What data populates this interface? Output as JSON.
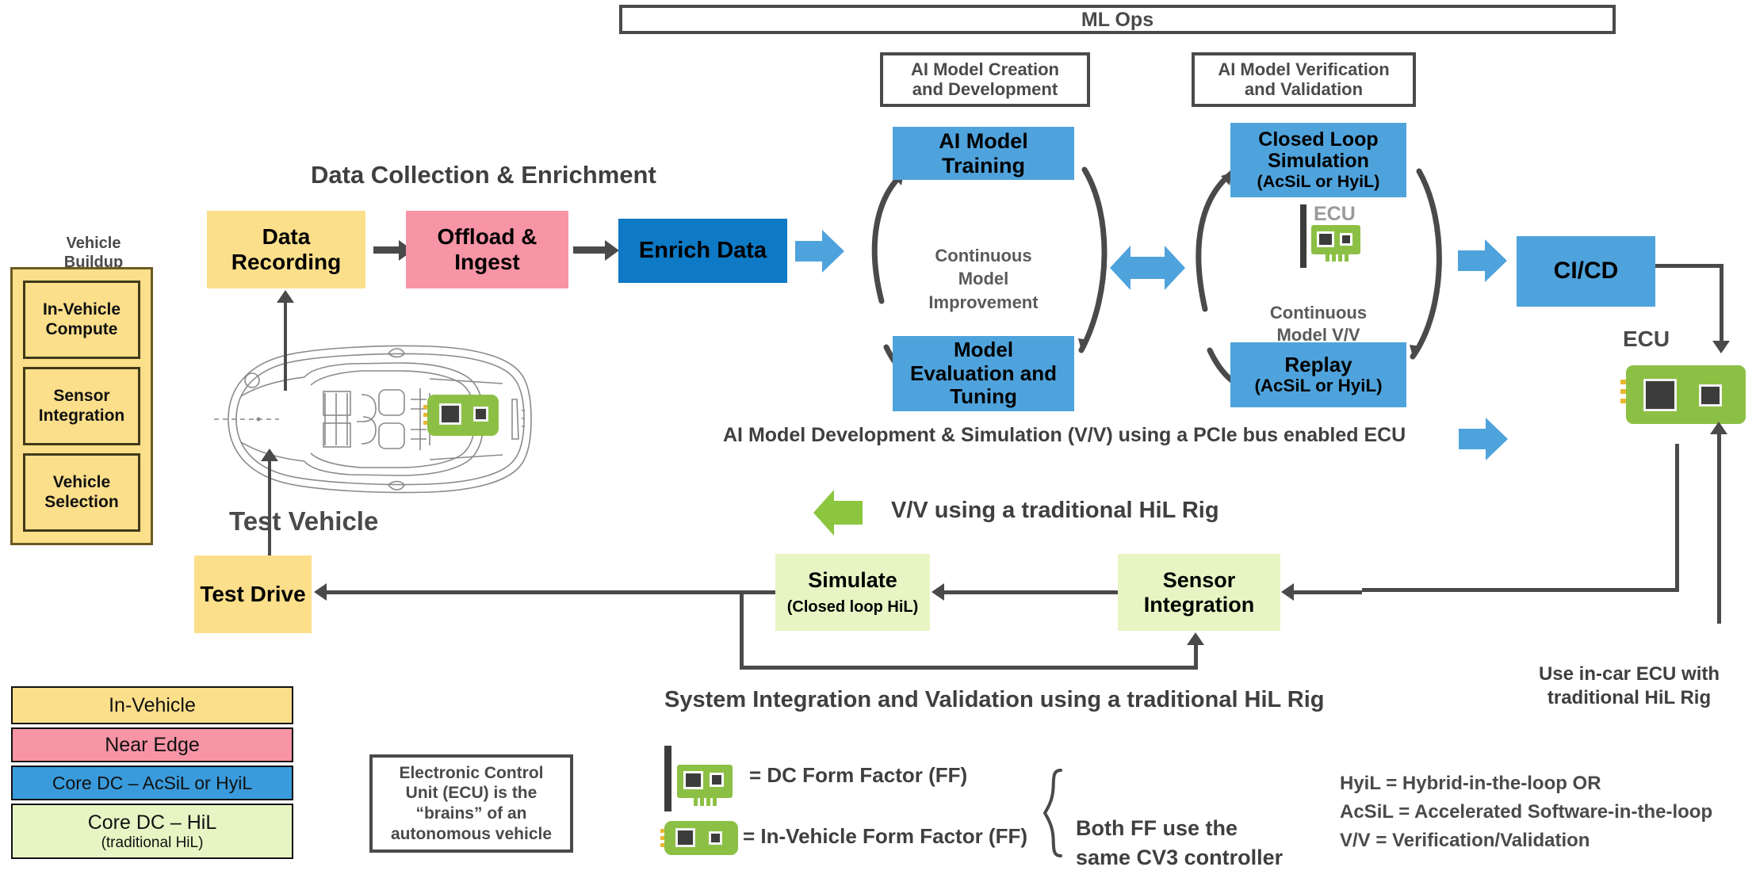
{
  "title_banner": {
    "label": "ML Ops"
  },
  "section_captions": {
    "creation": "AI Model Creation\nand Development",
    "verification": "AI Model Verification\nand Validation",
    "data_collection": "Data Collection & Enrichment",
    "ai_dev_sim": "AI Model Development & Simulation (V/V) using a PCIe bus enabled ECU",
    "vv_traditional": "V/V using a traditional HiL Rig",
    "system_integration": "System Integration and Validation using a traditional HiL Rig",
    "use_in_car_ecu": "Use in-car ECU with\ntraditional HiL Rig"
  },
  "vehicle_buildup": {
    "heading": "Vehicle\nBuildup",
    "items": [
      {
        "label": "In-Vehicle\nCompute"
      },
      {
        "label": "Sensor\nIntegration"
      },
      {
        "label": "Vehicle\nSelection"
      }
    ]
  },
  "flow": {
    "data_recording": {
      "label": "Data\nRecording",
      "color": "#FCDF8A"
    },
    "offload_ingest": {
      "label": "Offload &\nIngest",
      "color": "#F794A6"
    },
    "enrich_data": {
      "label": "Enrich Data",
      "color": "#0E79C4"
    },
    "ai_model_training": {
      "label": "AI Model\nTraining",
      "color": "#4FA3DC"
    },
    "model_eval_tuning": {
      "label": "Model\nEvaluation and\nTuning",
      "color": "#4FA3DC"
    },
    "continuous_model_improvement": {
      "label": "Continuous\nModel\nImprovement"
    },
    "closed_loop_simulation": {
      "label": "Closed Loop\nSimulation",
      "sub": "(AcSiL or HyiL)",
      "color": "#4FA3DC"
    },
    "replay": {
      "label": "Replay",
      "sub": "(AcSiL or HyiL)",
      "color": "#4FA3DC"
    },
    "continuous_model_vv": {
      "label": "Continuous\nModel  V/V"
    },
    "cicd": {
      "label": "CI/CD",
      "color": "#4FA3DC"
    },
    "test_drive": {
      "label": "Test Drive",
      "color": "#FCDF8A"
    },
    "simulate": {
      "label": "Simulate",
      "sub": "(Closed loop HiL)",
      "color": "#E7F5C4"
    },
    "sensor_integration": {
      "label": "Sensor\nIntegration",
      "color": "#E7F5C4"
    }
  },
  "vehicle_image": {
    "caption": "Test Vehicle"
  },
  "ecu_right": {
    "label": "ECU"
  },
  "ecu_cycle_icon": {
    "label": "ECU"
  },
  "legend": {
    "items": [
      {
        "label": "In-Vehicle",
        "sub": "",
        "color": "#FCDF8A"
      },
      {
        "label": "Near Edge",
        "sub": "",
        "color": "#F794A6"
      },
      {
        "label": "Core DC – AcSiL or HyiL",
        "sub": "",
        "color": "#3A9BDC"
      },
      {
        "label": "Core DC – HiL",
        "sub": "(traditional  HiL)",
        "color": "#E7F5C4"
      }
    ]
  },
  "ecu_definition": {
    "text": "Electronic Control\nUnit (ECU) is the\n“brains” of an\nautonomous vehicle"
  },
  "form_factors": {
    "dc_ff": "= DC Form Factor (FF)",
    "iv_ff": "= In-Vehicle Form Factor (FF)",
    "note": "Both FF use the\nsame CV3 controller"
  },
  "acronyms": [
    "HyiL = Hybrid-in-the-loop OR",
    "AcSiL = Accelerated Software-in-the-loop",
    "V/V = Verification/Validation"
  ],
  "colors": {
    "in_vehicle": "#FCDF8A",
    "near_edge": "#F794A6",
    "core_dc_blue": "#4FA3DC",
    "enrich_blue": "#0E79C4",
    "core_dc_hil": "#E7F5C4",
    "ecu_green": "#8CC044",
    "green_arrow": "#8CC63F",
    "line_gray": "#4a4a4a",
    "caption_gray": "#404040"
  }
}
